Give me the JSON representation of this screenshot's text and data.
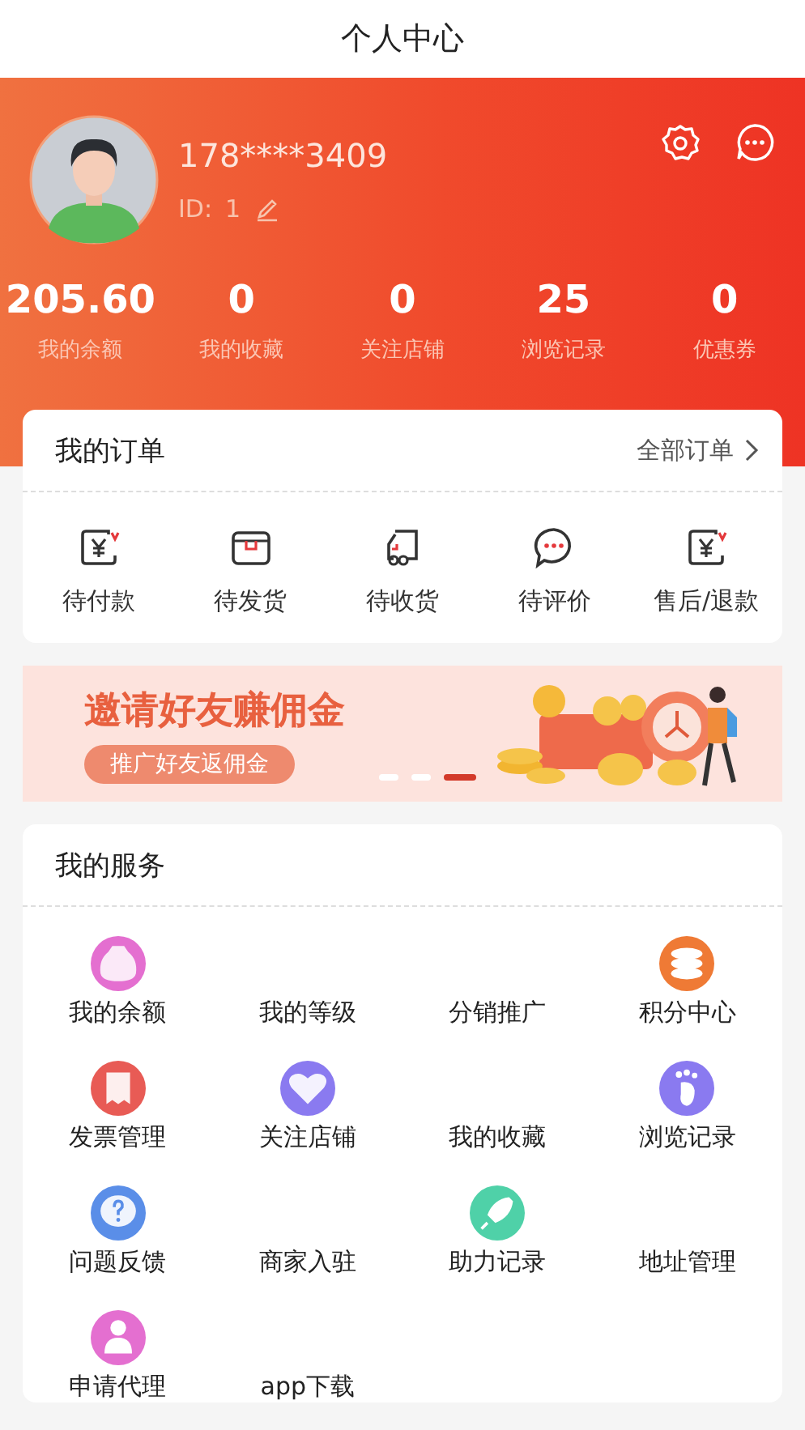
{
  "title": "个人中心",
  "profile": {
    "phone": "178****3409",
    "id_label": "ID:",
    "id_value": "1"
  },
  "stats": [
    {
      "value": "205.60",
      "label": "我的余额"
    },
    {
      "value": "0",
      "label": "我的收藏"
    },
    {
      "value": "0",
      "label": "关注店铺"
    },
    {
      "value": "25",
      "label": "浏览记录"
    },
    {
      "value": "0",
      "label": "优惠券"
    }
  ],
  "orders": {
    "title": "我的订单",
    "link": "全部订单",
    "items": [
      {
        "label": "待付款",
        "kind": "yen"
      },
      {
        "label": "待发货",
        "kind": "box"
      },
      {
        "label": "待收货",
        "kind": "truck"
      },
      {
        "label": "待评价",
        "kind": "chat"
      },
      {
        "label": "售后/退款",
        "kind": "yen"
      }
    ]
  },
  "banner": {
    "headline": "邀请好友赚佣金",
    "button": "推广好友返佣金",
    "dots": [
      {
        "selected": false
      },
      {
        "selected": false
      },
      {
        "selected": true
      }
    ]
  },
  "services": {
    "title": "我的服务",
    "items": [
      {
        "label": "我的余额",
        "kind": "moneybag",
        "color": "#e46fd0"
      },
      {
        "label": "我的等级",
        "kind": "plain"
      },
      {
        "label": "分销推广",
        "kind": "plain"
      },
      {
        "label": "积分中心",
        "kind": "coins",
        "color": "#ef7a35"
      },
      {
        "label": "发票管理",
        "kind": "receipt",
        "color": "#e85b55"
      },
      {
        "label": "关注店铺",
        "kind": "heart",
        "color": "#8a7af0"
      },
      {
        "label": "我的收藏",
        "kind": "plain"
      },
      {
        "label": "浏览记录",
        "kind": "foot",
        "color": "#8a7af0"
      },
      {
        "label": "问题反馈",
        "kind": "question",
        "color": "#5a8ee8"
      },
      {
        "label": "商家入驻",
        "kind": "plain"
      },
      {
        "label": "助力记录",
        "kind": "rocket",
        "color": "#4fd1a8"
      },
      {
        "label": "地址管理",
        "kind": "plain"
      },
      {
        "label": "申请代理",
        "kind": "person",
        "color": "#e46fd0"
      },
      {
        "label": "app下载",
        "kind": "plain"
      }
    ]
  }
}
